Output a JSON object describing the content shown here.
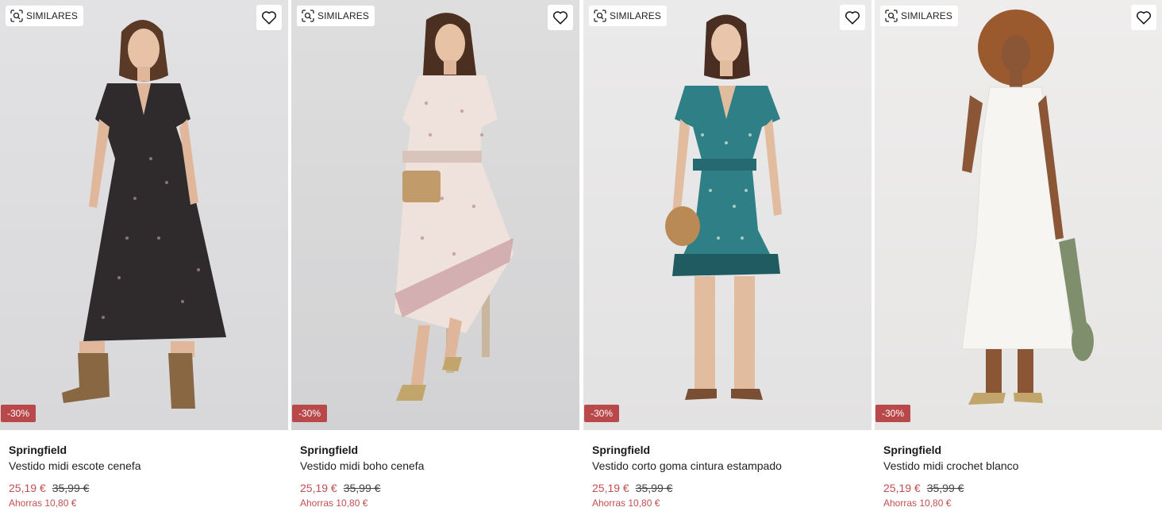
{
  "products": [
    {
      "similar_label": "SIMILARES",
      "discount": "-30%",
      "brand": "Springfield",
      "name": "Vestido midi escote cenefa",
      "price_now": "25,19 €",
      "price_old": "35,99 €",
      "savings": "Ahorras 10,80 €",
      "dress_color": "#2f2a2b"
    },
    {
      "similar_label": "SIMILARES",
      "discount": "-30%",
      "brand": "Springfield",
      "name": "Vestido midi boho cenefa",
      "price_now": "25,19 €",
      "price_old": "35,99 €",
      "savings": "Ahorras 10,80 €",
      "dress_color": "#efe2dc"
    },
    {
      "similar_label": "SIMILARES",
      "discount": "-30%",
      "brand": "Springfield",
      "name": "Vestido corto goma cintura estampado",
      "price_now": "25,19 €",
      "price_old": "35,99 €",
      "savings": "Ahorras 10,80 €",
      "dress_color": "#2f7f86"
    },
    {
      "similar_label": "SIMILARES",
      "discount": "-30%",
      "brand": "Springfield",
      "name": "Vestido midi crochet blanco",
      "price_now": "25,19 €",
      "price_old": "35,99 €",
      "savings": "Ahorras 10,80 €",
      "dress_color": "#f6f5f2"
    }
  ],
  "colors": {
    "discount_bg": "#b8484a",
    "sale_price": "#c0504f"
  },
  "icons": {
    "similar": "visual-search-icon",
    "favorite": "heart-outline-icon"
  }
}
